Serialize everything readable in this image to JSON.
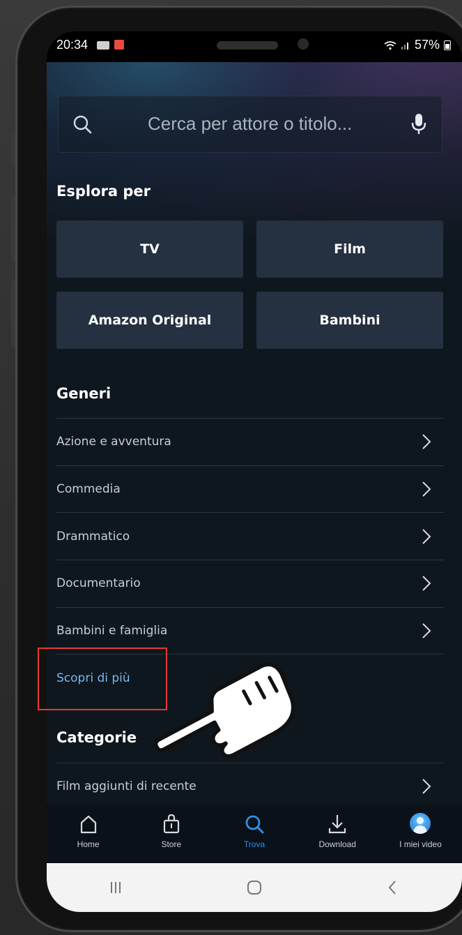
{
  "status_bar": {
    "time": "20:34",
    "battery": "57%"
  },
  "search": {
    "placeholder": "Cerca per attore o titolo..."
  },
  "explore": {
    "title": "Esplora per",
    "tiles": [
      "TV",
      "Film",
      "Amazon Original",
      "Bambini"
    ]
  },
  "genres": {
    "title": "Generi",
    "items": [
      "Azione e avventura",
      "Commedia",
      "Drammatico",
      "Documentario",
      "Bambini e famiglia"
    ],
    "more_label": "Scopri di più"
  },
  "categories": {
    "title": "Categorie",
    "items": [
      "Film aggiunti di recente"
    ]
  },
  "bottom_nav": {
    "items": [
      {
        "label": "Home",
        "icon": "home-icon"
      },
      {
        "label": "Store",
        "icon": "store-bag-icon"
      },
      {
        "label": "Trova",
        "icon": "search-icon",
        "active": true
      },
      {
        "label": "Download",
        "icon": "download-icon"
      },
      {
        "label": "I miei video",
        "icon": "profile-avatar-icon"
      }
    ]
  },
  "colors": {
    "accent": "#2f8fe8",
    "link": "#79b8f3",
    "highlight": "#e53935",
    "background": "#0f171e"
  }
}
